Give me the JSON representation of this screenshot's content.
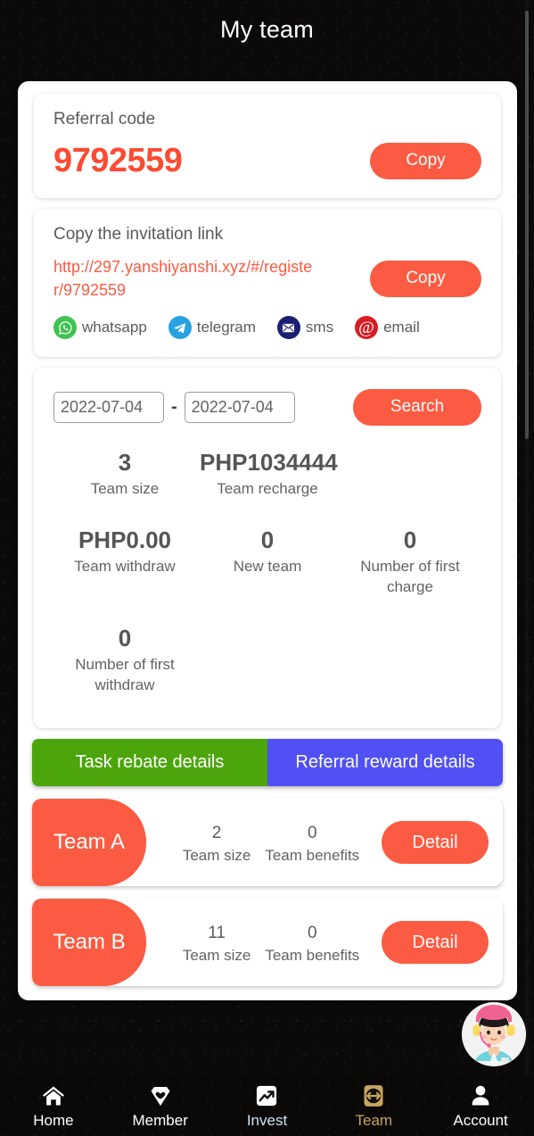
{
  "header": {
    "title": "My team"
  },
  "referral": {
    "label": "Referral code",
    "code": "9792559",
    "copy_label": "Copy"
  },
  "invitation": {
    "label": "Copy the invitation link",
    "url": "http://297.yanshiyanshi.xyz/#/register/9792559",
    "copy_label": "Copy",
    "share": [
      {
        "name": "whatsapp-icon",
        "label": "whatsapp",
        "color": "#3fc351"
      },
      {
        "name": "telegram-icon",
        "label": "telegram",
        "color": "#28a2e2"
      },
      {
        "name": "sms-icon",
        "label": "sms",
        "color": "#1b1f71"
      },
      {
        "name": "email-icon",
        "label": "email",
        "color": "#d81c22"
      }
    ]
  },
  "search": {
    "date_from": "2022-07-04",
    "date_to": "2022-07-04",
    "separator": "-",
    "button_label": "Search"
  },
  "stats": [
    {
      "value": "3",
      "caption": "Team size"
    },
    {
      "value": "PHP1034444",
      "caption": "Team recharge"
    },
    {
      "value": "",
      "caption": ""
    },
    {
      "value": "PHP0.00",
      "caption": "Team withdraw"
    },
    {
      "value": "0",
      "caption": "New team"
    },
    {
      "value": "0",
      "caption": "Number of first charge"
    },
    {
      "value": "0",
      "caption": "Number of first withdraw"
    }
  ],
  "tabs": [
    {
      "label": "Task rebate details",
      "color": "#4ca50d"
    },
    {
      "label": "Referral reward details",
      "color": "#5050f5"
    }
  ],
  "teams": [
    {
      "name": "Team A",
      "size_value": "2",
      "size_caption": "Team size",
      "benefits_value": "0",
      "benefits_caption": "Team benefits",
      "detail_label": "Detail"
    },
    {
      "name": "Team B",
      "size_value": "11",
      "size_caption": "Team size",
      "benefits_value": "0",
      "benefits_caption": "Team benefits",
      "detail_label": "Detail"
    }
  ],
  "bottom_nav": [
    {
      "label": "Home",
      "icon": "home-icon",
      "active": false
    },
    {
      "label": "Member",
      "icon": "diamond-heart-icon",
      "active": false
    },
    {
      "label": "Invest",
      "icon": "chart-trend-icon",
      "active": false
    },
    {
      "label": "Team",
      "icon": "arrows-exchange-icon",
      "active": true
    },
    {
      "label": "Account",
      "icon": "person-icon",
      "active": false
    }
  ],
  "colors": {
    "accent_orange": "#fb5b42",
    "code_red": "#fb4b32",
    "tab_green": "#4ca50d",
    "tab_blue": "#5050f5",
    "nav_active": "#c7a55e",
    "background": "#0c0a09"
  },
  "support": {
    "label": "customer-service"
  }
}
